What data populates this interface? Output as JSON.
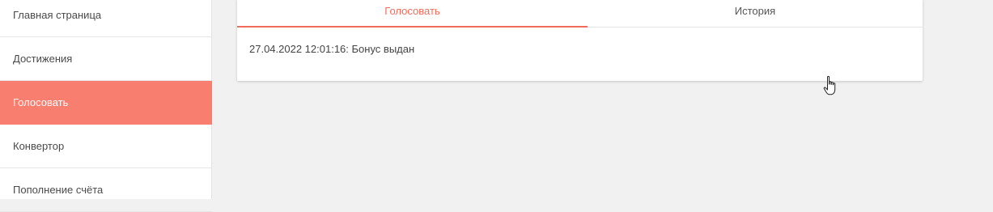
{
  "sidebar": {
    "items": [
      {
        "label": "Главная страница"
      },
      {
        "label": "Достижения"
      },
      {
        "label": "Голосовать",
        "active": true
      },
      {
        "label": "Конвертор"
      },
      {
        "label": "Пополнение счёта"
      }
    ]
  },
  "tabs": [
    {
      "label": "Голосовать",
      "active": true
    },
    {
      "label": "История",
      "active": false
    }
  ],
  "history": {
    "entry": "27.04.2022 12:01:16: Бонус выдан"
  },
  "colors": {
    "accent": "#f87e70",
    "accent_text": "#f26c5d"
  },
  "cursor": {
    "icon": "hand-pointer-icon"
  }
}
